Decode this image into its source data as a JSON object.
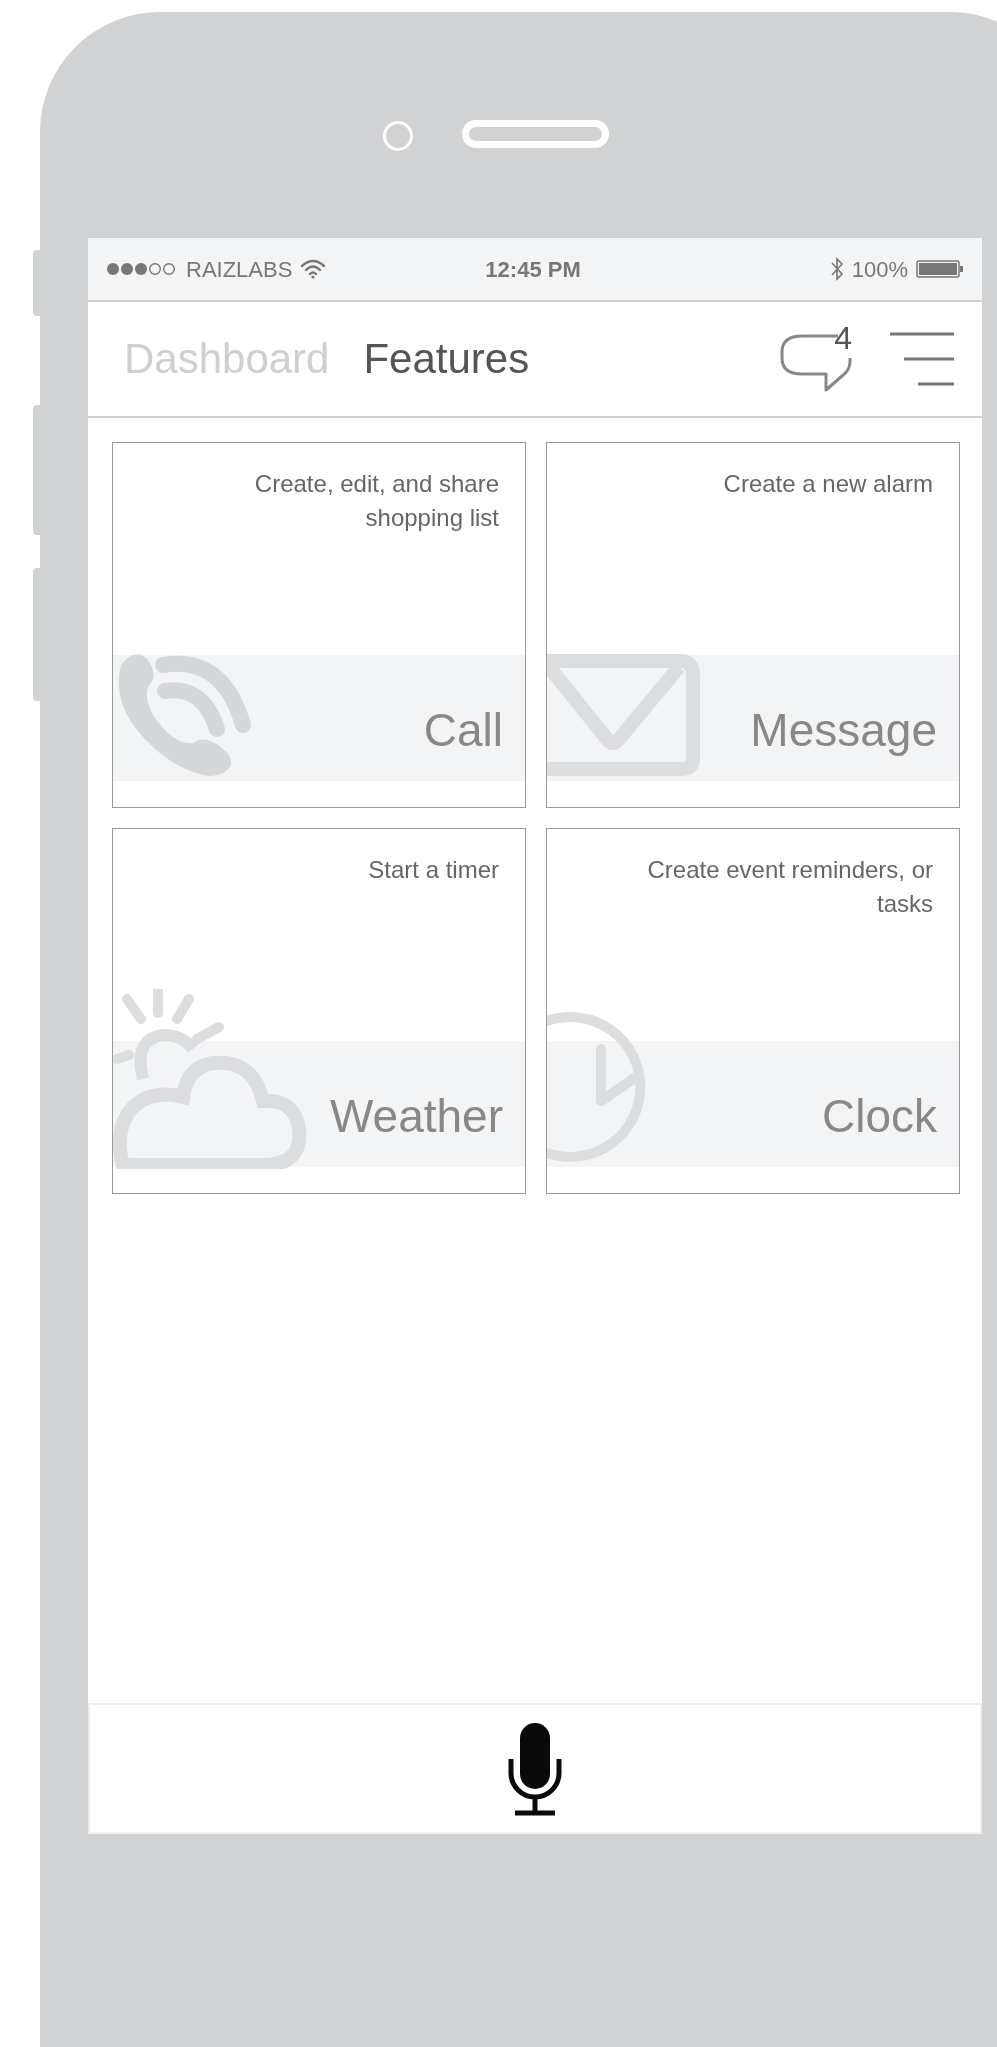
{
  "status_bar": {
    "carrier": "RAIZLABS",
    "time": "12:45 PM",
    "battery": "100%"
  },
  "header": {
    "tabs": [
      {
        "label": "Dashboard",
        "selected": false
      },
      {
        "label": "Features",
        "selected": true
      }
    ],
    "message_count": "4"
  },
  "tiles": [
    {
      "kind": "call",
      "title": "Call",
      "description": "Create, edit, and share shopping list"
    },
    {
      "kind": "message",
      "title": "Message",
      "description": "Create a new alarm"
    },
    {
      "kind": "weather",
      "title": "Weather",
      "description": "Start a timer"
    },
    {
      "kind": "clock",
      "title": "Clock",
      "description": "Create event reminders, or tasks"
    }
  ]
}
